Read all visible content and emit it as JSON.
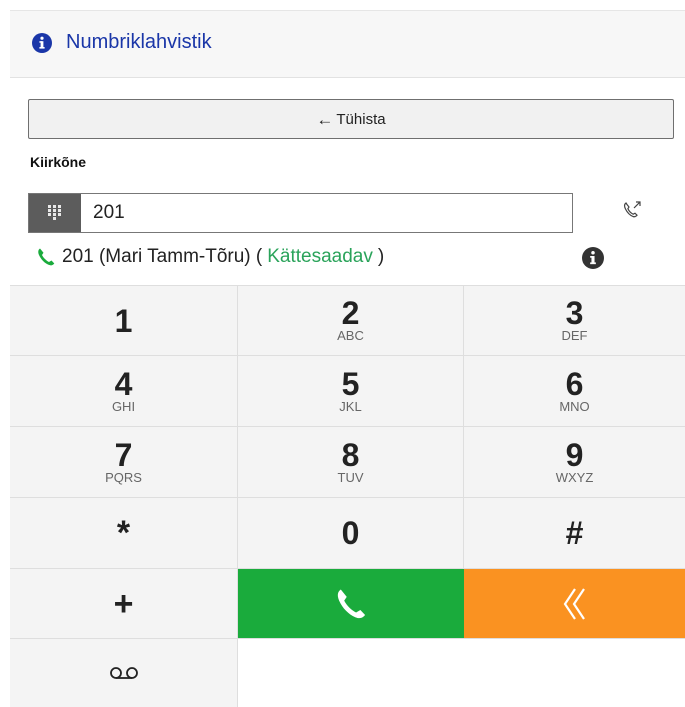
{
  "header": {
    "title": "Numbriklahvistik",
    "icon": "info-circle-icon"
  },
  "cancel_button": {
    "label": "Tühista",
    "icon": "arrow-left-icon"
  },
  "quick_call": {
    "label": "Kiirkõne",
    "input_value": "201",
    "keypad_icon": "keypad-icon",
    "transfer_icon": "call-transfer-icon"
  },
  "contact": {
    "text": "201 (Mari Tamm-Tõru) (",
    "status": "Kättesaadav",
    "close": ")",
    "status_color": "#2aa35a",
    "phone_icon": "phone-icon",
    "info_icon": "info-circle-icon"
  },
  "keys": [
    {
      "digit": "1",
      "letters": ""
    },
    {
      "digit": "2",
      "letters": "ABC"
    },
    {
      "digit": "3",
      "letters": "DEF"
    },
    {
      "digit": "4",
      "letters": "GHI"
    },
    {
      "digit": "5",
      "letters": "JKL"
    },
    {
      "digit": "6",
      "letters": "MNO"
    },
    {
      "digit": "7",
      "letters": "PQRS"
    },
    {
      "digit": "8",
      "letters": "TUV"
    },
    {
      "digit": "9",
      "letters": "WXYZ"
    },
    {
      "digit": "*",
      "letters": ""
    },
    {
      "digit": "0",
      "letters": ""
    },
    {
      "digit": "#",
      "letters": ""
    },
    {
      "digit": "+",
      "letters": ""
    }
  ],
  "actions": {
    "call_icon": "phone-call-icon",
    "call_color": "#1aab3c",
    "backspace_icon": "double-chevron-left-icon",
    "backspace_color": "#fa9221",
    "voicemail_icon": "voicemail-icon"
  }
}
